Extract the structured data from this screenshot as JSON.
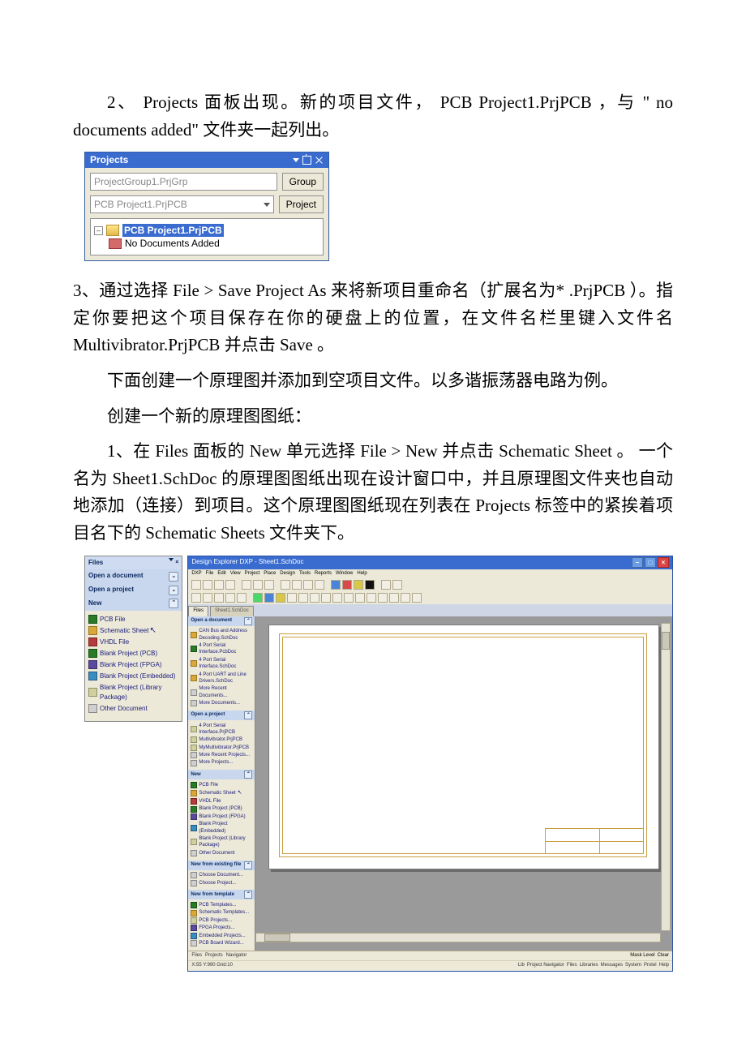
{
  "para1": "2、 Projects 面板出现。新的项目文件， PCB Project1.PrjPCB ，与 \" no documents added\" 文件夹一起列出。",
  "projects_panel": {
    "title": "Projects",
    "group_dd": "ProjectGroup1.PrjGrp",
    "project_dd": "PCB Project1.PrjPCB",
    "group_btn": "Group",
    "project_btn": "Project",
    "toggle": "–",
    "project_name": "PCB Project1.PrjPCB",
    "no_docs": "No Documents Added"
  },
  "para2": "3、通过选择 File > Save Project As 来将新项目重命名（扩展名为* .PrjPCB ）。指定你要把这个项目保存在你的硬盘上的位置，在文件名栏里键入文件名 Multivibrator.PrjPCB 并点击 Save 。",
  "para3": "下面创建一个原理图并添加到空项目文件。以多谐振荡器电路为例。",
  "para4": "创建一个新的原理图图纸：",
  "para5": "1、在 Files 面板的 New 单元选择 File > New 并点击 Schematic Sheet 。 一个名为 Sheet1.SchDoc 的原理图图纸出现在设计窗口中，并且原理图文件夹也自动地添加（连接）到项目。这个原理图图纸现在列表在 Projects 标签中的紧挨着项目名下的 Schematic Sheets 文件夹下。",
  "files_panel": {
    "title": "Files",
    "sections": {
      "open_doc": "Open a document",
      "open_proj": "Open a project",
      "new": "New"
    },
    "items": {
      "pcb": "PCB File",
      "sch": "Schematic Sheet",
      "vhdl": "VHDL File",
      "blank_pcb": "Blank Project (PCB)",
      "blank_fpga": "Blank Project (FPGA)",
      "blank_emb": "Blank Project (Embedded)",
      "blank_lib": "Blank Project (Library Package)",
      "other": "Other Document"
    }
  },
  "dxp": {
    "title": "Design Explorer DXP - Sheet1.SchDoc",
    "menu": [
      "DXP",
      "File",
      "Edit",
      "View",
      "Project",
      "Place",
      "Design",
      "Tools",
      "Reports",
      "Window",
      "Help"
    ],
    "tabs": {
      "files": "Files",
      "sheet": "Sheet1.SchDoc"
    },
    "side": {
      "open_doc": "Open a document",
      "open_doc_items": [
        "CAN Bus and Address Decoding.SchDoc",
        "4 Port Serial Interface.PcbDoc",
        "4 Port Serial Interface.SchDoc",
        "4 Port UART and Line Drivers.SchDoc",
        "More Recent Documents...",
        "More Documents..."
      ],
      "open_proj": "Open a project",
      "open_proj_items": [
        "4 Port Serial Interface.PrjPCB",
        "Multivibrator.PrjPCB",
        "MyMultivibrator.PrjPCB",
        "More Recent Projects...",
        "More Projects..."
      ],
      "new": "New",
      "new_items": [
        "PCB File",
        "Schematic Sheet",
        "VHDL File",
        "Blank Project (PCB)",
        "Blank Project (FPGA)",
        "Blank Project (Embedded)",
        "Blank Project (Library Package)",
        "Other Document"
      ],
      "existing": "New from existing file",
      "existing_items": [
        "Choose Document...",
        "Choose Project..."
      ],
      "template": "New from template",
      "template_items": [
        "PCB Templates...",
        "Schematic Templates...",
        "PCB Projects...",
        "FPGA Projects...",
        "Embedded Projects...",
        "PCB Board Wizard..."
      ]
    },
    "status_left_tabs": [
      "Files",
      "Projects",
      "Navigator"
    ],
    "status_right_top": [
      "Mask Level",
      "Clear"
    ],
    "status_coords": "X:55 Y:990  Grid:10",
    "status_right": [
      "Lib",
      "Project Navigator",
      "Files",
      "Libraries",
      "Messages",
      "System",
      "Protel",
      "Help"
    ]
  }
}
